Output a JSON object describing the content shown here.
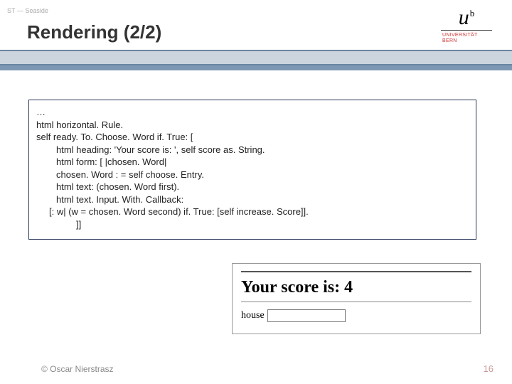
{
  "header": {
    "topLabel": "ST — Seaside",
    "title": "Rendering (2/2)"
  },
  "logo": {
    "letter": "u",
    "super": "b",
    "line1": "UNIVERSITÄT",
    "line2": "BERN"
  },
  "code": {
    "l0": "…",
    "l1": "html horizontal. Rule.",
    "l2": "self ready. To. Choose. Word if. True: [",
    "l3": "html heading: 'Your score is: ', self score as. String.",
    "l4": "html form: [ |chosen. Word|",
    "l5": "chosen. Word : = self choose. Entry.",
    "l6": "html text: (chosen. Word first).",
    "l7": "html text. Input. With. Callback:",
    "l8": "[: w| (w = chosen. Word second) if. True: [self increase. Score]].",
    "l9": "]]"
  },
  "inset": {
    "heading": "Your score is: 4",
    "word": "house",
    "inputValue": ""
  },
  "footer": {
    "credit": "© Oscar Nierstrasz",
    "page": "16"
  }
}
